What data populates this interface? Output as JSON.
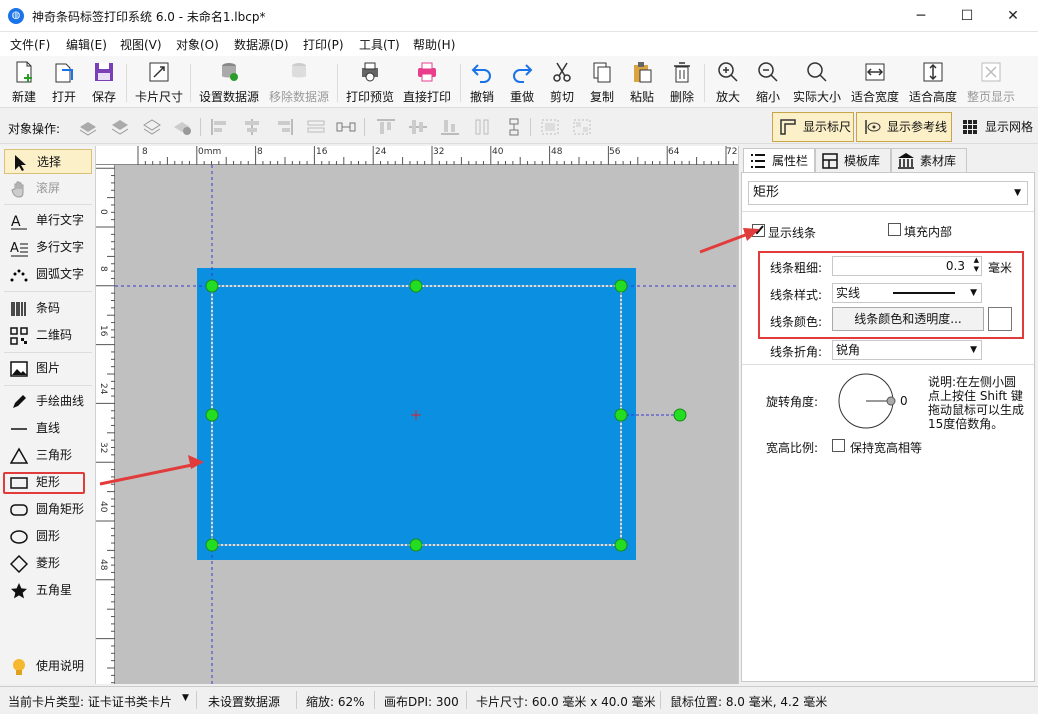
{
  "window": {
    "title": "神奇条码标签打印系统 6.0 - 未命名1.lbcp*",
    "app_icon": "globe-icon"
  },
  "menu": [
    "文件(F)",
    "编辑(E)",
    "视图(V)",
    "对象(O)",
    "数据源(D)",
    "打印(P)",
    "工具(T)",
    "帮助(H)"
  ],
  "toolbar": {
    "new": "新建",
    "open": "打开",
    "save": "保存",
    "card_size": "卡片尺寸",
    "set_datasource": "设置数据源",
    "remove_datasource": "移除数据源",
    "print_preview": "打印预览",
    "direct_print": "直接打印",
    "undo": "撤销",
    "redo": "重做",
    "cut": "剪切",
    "copy": "复制",
    "paste": "粘贴",
    "delete": "删除",
    "zoom_in": "放大",
    "zoom_out": "缩小",
    "actual_size": "实际大小",
    "fit_width": "适合宽度",
    "fit_height": "适合高度",
    "fit_page": "整页显示"
  },
  "objbar": {
    "label": "对象操作:",
    "show_ruler": "显示标尺",
    "show_guides": "显示参考线",
    "show_grid": "显示网格"
  },
  "tools": {
    "select": "选择",
    "scroll": "滚屏",
    "single_text": "单行文字",
    "multi_text": "多行文字",
    "arc_text": "圆弧文字",
    "barcode": "条码",
    "qrcode": "二维码",
    "image": "图片",
    "freehand": "手绘曲线",
    "line": "直线",
    "triangle": "三角形",
    "rectangle": "矩形",
    "round_rect": "圆角矩形",
    "circle": "圆形",
    "diamond": "菱形",
    "star": "五角星",
    "help": "使用说明"
  },
  "ruler": {
    "top_labels": [
      "8",
      "0mm",
      "8",
      "16",
      "24",
      "32",
      "40",
      "48",
      "56",
      "64",
      "72"
    ],
    "left_labels": [
      "0",
      "8",
      "16",
      "24",
      "32",
      "40",
      "48"
    ]
  },
  "panel": {
    "tabs": [
      "属性栏",
      "模板库",
      "素材库"
    ],
    "object_type": "矩形",
    "show_line": "显示线条",
    "show_line_checked": true,
    "fill_inside": "填充内部",
    "fill_inside_checked": false,
    "line_width_label": "线条粗细:",
    "line_width_value": "0.3",
    "line_width_unit": "毫米",
    "line_style_label": "线条样式:",
    "line_style_value": "实线",
    "line_color_label": "线条颜色:",
    "line_color_button": "线条颜色和透明度...",
    "line_corner_label": "线条折角:",
    "line_corner_value": "锐角",
    "rotation_label": "旋转角度:",
    "rotation_value": "0",
    "rotation_help": "说明:在左侧小圆点上按住 Shift 键拖动鼠标可以生成15度倍数角。",
    "aspect_label": "宽高比例:",
    "keep_aspect": "保持宽高相等",
    "keep_aspect_checked": false
  },
  "status": {
    "card_type": "当前卡片类型: 证卡证书类卡片",
    "datasource": "未设置数据源",
    "zoom": "缩放: 62%",
    "dpi": "画布DPI: 300",
    "card_size": "卡片尺寸: 60.0 毫米 x 40.0 毫米",
    "mouse_pos": "鼠标位置: 8.0 毫米, 4.2 毫米"
  },
  "colors": {
    "card_fill": "#0b8fe0",
    "handle": "#22dd22",
    "highlight": "#e23b3b",
    "canvas": "#c0c0c0"
  }
}
